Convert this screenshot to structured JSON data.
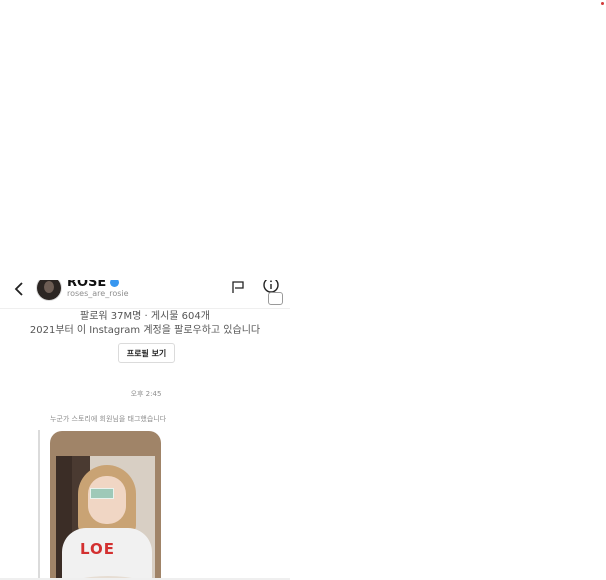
{
  "header": {
    "name": "ROSÉ",
    "username": "roses_are_rosie",
    "icons": [
      "back-icon",
      "verified-icon",
      "flag-icon",
      "info-icon"
    ]
  },
  "profile": {
    "stats": "팔로워 37M명 · 게시물 604개",
    "follow_note": "2021부터 이 Instagram 계정을 팔로우하고 있습니다",
    "view_profile_label": "프로필 보기"
  },
  "thread": {
    "timestamp": "오후 2:45",
    "story_note": "누군가 스토리에 회원님을 태그했습니다",
    "shirt_text": "LOE"
  }
}
